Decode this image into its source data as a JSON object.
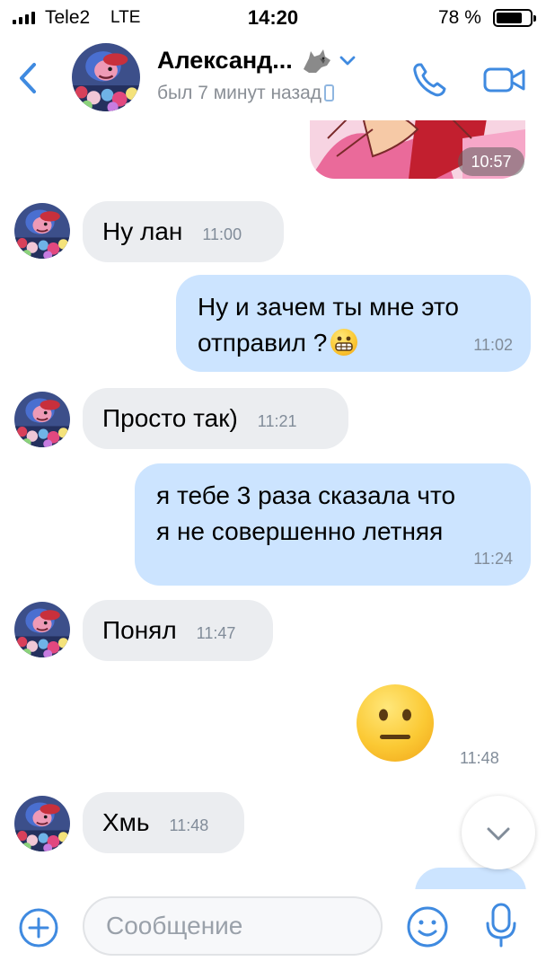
{
  "status_bar": {
    "carrier": "Tele2",
    "network": "LTE",
    "time": "14:20",
    "battery_percent": "78 %",
    "battery_level": 0.78
  },
  "header": {
    "contact_name": "Александ...",
    "contact_status": "был 7 минут назад",
    "name_icon": "wolf-icon",
    "back_icon": "chevron-left-icon",
    "call_icon": "phone-icon",
    "video_icon": "video-camera-icon"
  },
  "chat": {
    "image_message_time": "10:57",
    "messages": [
      {
        "direction": "in",
        "lines": [
          "Ну лан"
        ],
        "time": "11:00"
      },
      {
        "direction": "out",
        "lines": [
          "Ну и зачем ты мне это",
          "отправил ?"
        ],
        "emoji": "grimacing-face",
        "time": "11:02"
      },
      {
        "direction": "in",
        "lines": [
          "Просто так)"
        ],
        "time": "11:21"
      },
      {
        "direction": "out",
        "lines": [
          "я тебе 3 раза сказала что",
          "я не совершенно летняя"
        ],
        "time": "11:24"
      },
      {
        "direction": "in",
        "lines": [
          "Понял"
        ],
        "time": "11:47"
      },
      {
        "direction": "out",
        "emoji": "neutral-face",
        "time": "11:48"
      },
      {
        "direction": "in",
        "lines": [
          "Хмь"
        ],
        "time": "11:48"
      }
    ],
    "scroll_down_icon": "chevron-down-icon"
  },
  "composer": {
    "placeholder": "Сообщение",
    "value": "",
    "add_icon": "plus-circle-icon",
    "emoji_icon": "smile-icon",
    "mic_icon": "microphone-icon"
  },
  "colors": {
    "accent": "#3f8ae0",
    "incoming_bubble": "#ebedf0",
    "outgoing_bubble": "#cce4ff",
    "time_text": "#818c99",
    "status_text": "#8a8f96"
  }
}
